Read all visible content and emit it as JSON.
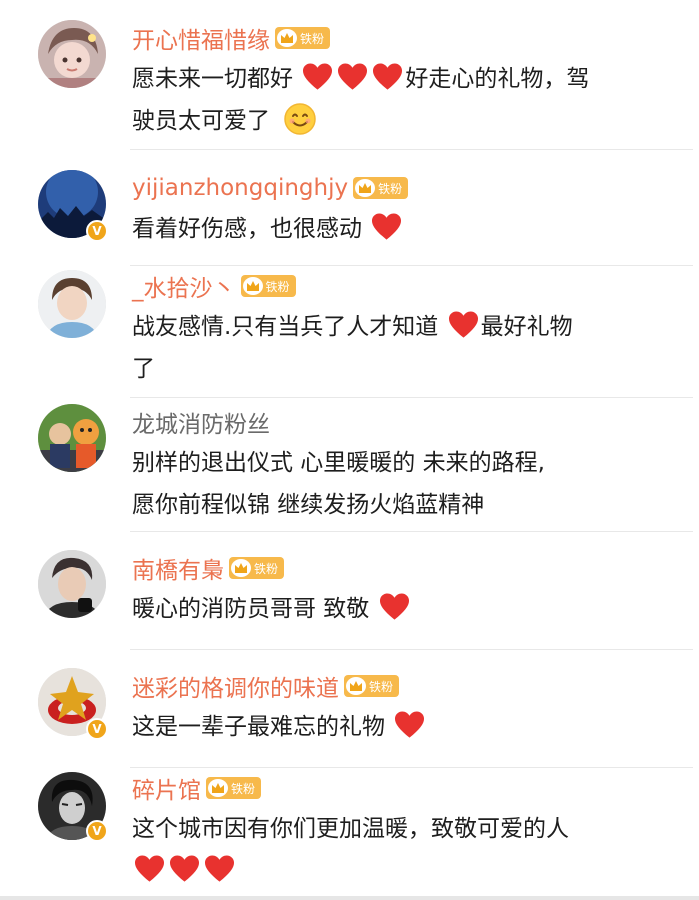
{
  "comments": [
    {
      "username": "开心惜福惜缘",
      "fan_badge": "铁粉",
      "verified": false,
      "segments": [
        {
          "t": "愿未来一切都好 "
        },
        {
          "heart": true
        },
        {
          "heart": true
        },
        {
          "heart": true
        },
        {
          "t": "好走心的礼物，驾"
        }
      ],
      "line2": "驶员太可爱了",
      "line2_emoji": "smiling-face-emoji"
    },
    {
      "username": "yijianzhongqinghjy",
      "fan_badge": "铁粉",
      "verified": true,
      "segments": [
        {
          "t": "看着好伤感，也很感动 "
        },
        {
          "heart": true
        }
      ]
    },
    {
      "username": "_水拾沙丶",
      "fan_badge": "铁粉",
      "verified": false,
      "segments": [
        {
          "t": "战友感情.只有当兵了人才知道 "
        },
        {
          "heart": true
        },
        {
          "t": "最好礼物"
        }
      ],
      "line2": "了"
    },
    {
      "username": "龙城消防粉丝",
      "username_plain": true,
      "verified": false,
      "segments": [
        {
          "t": "别样的退出仪式 心里暖暖的 未来的路程,"
        }
      ],
      "line2": "愿你前程似锦 继续发扬火焰蓝精神"
    },
    {
      "username": "南橋有梟",
      "fan_badge": "铁粉",
      "verified": false,
      "segments": [
        {
          "t": "暖心的消防员哥哥 致敬 "
        },
        {
          "heart": true
        }
      ]
    },
    {
      "username": "迷彩的格调你的味道",
      "fan_badge": "铁粉",
      "verified": true,
      "segments": [
        {
          "t": "这是一辈子最难忘的礼物 "
        },
        {
          "heart": true
        }
      ]
    },
    {
      "username": "碎片馆",
      "fan_badge": "铁粉",
      "verified": true,
      "segments": [
        {
          "t": "这个城市因有你们更加温暖，致敬可爱的人"
        }
      ],
      "line2_hearts": 3
    }
  ],
  "colors": {
    "username": "#eb7350",
    "username_plain": "#6a6a6a",
    "fan_badge": "#f7b94b",
    "heart": "#e8322f",
    "verified": "#f0a51a"
  },
  "icons": {
    "verified": "verified-v-icon",
    "fan": "crown-icon",
    "heart": "red-heart-icon"
  }
}
